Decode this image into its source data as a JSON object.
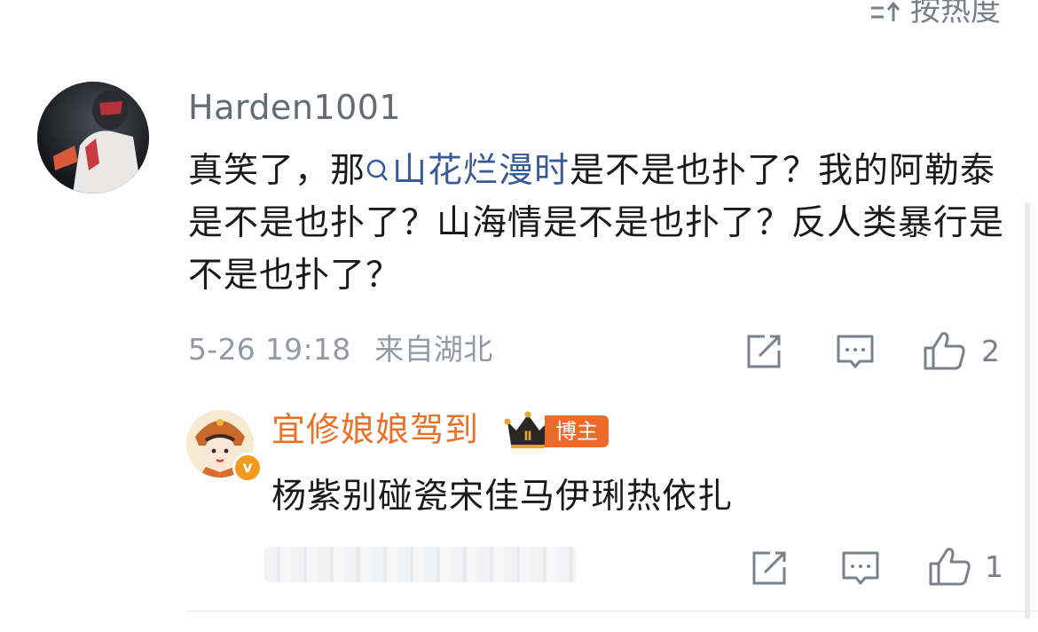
{
  "sort": {
    "icon": "sort-arrows-icon",
    "label": "按热度"
  },
  "comment": {
    "avatar": "user-avatar",
    "username": "Harden1001",
    "text_before": "真笑了，那",
    "topic_link": "山花烂漫时",
    "text_after": "是不是也扑了？我的阿勒泰是不是也扑了？山海情是不是也扑了？反人类暴行是不是也扑了？",
    "date": "5-26 19:18",
    "location": "来自湖北",
    "like_count": "2",
    "actions": [
      "share-edit-icon",
      "comment-icon",
      "thumbs-up-icon"
    ]
  },
  "reply": {
    "avatar": "user-avatar",
    "verified_badge": "v",
    "username": "宜修娘娘驾到",
    "crown_level": "Ⅱ",
    "author_tag": "博主",
    "text": "杨紫别碰瓷宋佳马伊琍热依扎",
    "like_count": "1"
  },
  "colors": {
    "link": "#385b95",
    "reply_username": "#e9722b",
    "author_tag_bg": "#ec6a2c",
    "meta_text": "#959aa2",
    "icon": "#7b8089"
  }
}
